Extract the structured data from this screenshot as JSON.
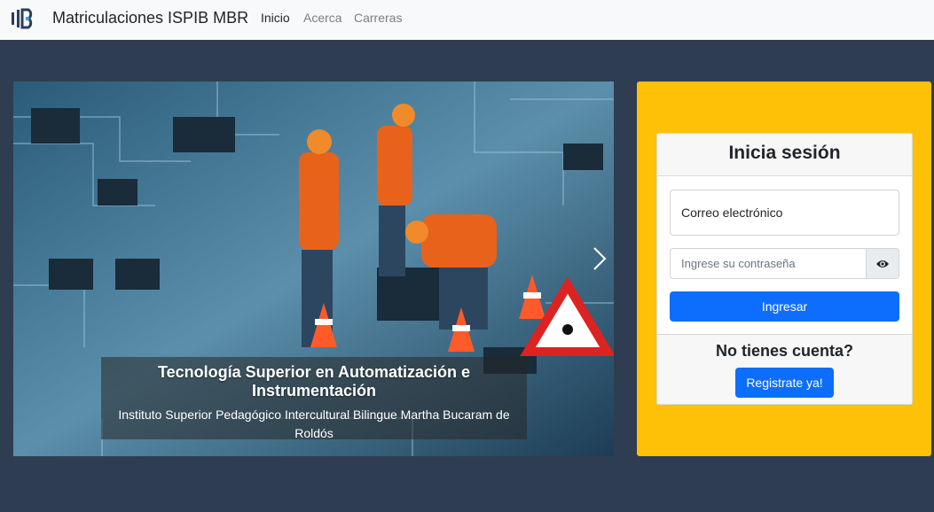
{
  "navbar": {
    "brand": "Matriculaciones ISPIB MBR",
    "links": [
      {
        "label": "Inicio",
        "active": true
      },
      {
        "label": "Acerca",
        "active": false
      },
      {
        "label": "Carreras",
        "active": false
      }
    ]
  },
  "carousel": {
    "caption_title": "Tecnología Superior en Automatización e Instrumentación",
    "caption_subtitle": "Instituto Superior Pedagógico Intercultural Bilingue Martha Bucaram de Roldós",
    "next_icon": "chevron-right-icon"
  },
  "login": {
    "title": "Inicia sesión",
    "email_placeholder": "Correo electrónico",
    "password_placeholder": "Ingrese su contraseña",
    "toggle_icon": "eye-icon",
    "submit_label": "Ingresar",
    "footer_text": "No tienes cuenta?",
    "register_label": "Registrate ya!"
  },
  "colors": {
    "page_bg": "#2f3d52",
    "panel": "#ffc107",
    "primary": "#0d6efd"
  }
}
